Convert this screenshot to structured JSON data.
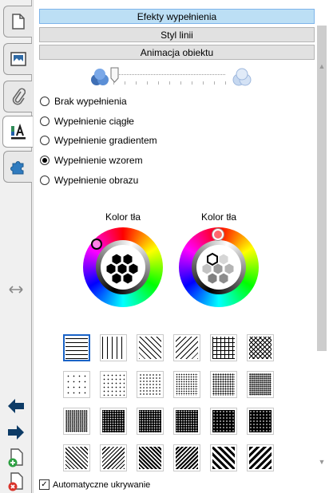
{
  "sections": {
    "fill_effects": "Efekty wypełnienia",
    "line_style": "Styl linii",
    "object_animation": "Animacja obiektu"
  },
  "transparency": {
    "value": 0
  },
  "fill_options": [
    {
      "label": "Brak wypełnienia",
      "checked": false
    },
    {
      "label": "Wypełnienie ciągłe",
      "checked": false
    },
    {
      "label": "Wypełnienie gradientem",
      "checked": false
    },
    {
      "label": "Wypełnienie wzorem",
      "checked": true
    },
    {
      "label": "Wypełnienie obrazu",
      "checked": false
    }
  ],
  "color_pickers": [
    {
      "label": "Kolor tła",
      "selected_color": "#000000"
    },
    {
      "label": "Kolor tła",
      "selected_color": "#ffffff"
    }
  ],
  "patterns": {
    "selected_index": 0,
    "items": [
      "horizontal-lines",
      "vertical-lines",
      "diagonal-down",
      "diagonal-up",
      "grid",
      "diagonal-cross",
      "dots-5",
      "dots-10",
      "dots-20",
      "dots-25",
      "dots-30",
      "dots-40",
      "dots-50",
      "dots-60",
      "dots-70",
      "dots-75",
      "dots-80",
      "dots-90",
      "wide-diagonal-down",
      "wide-diagonal-up",
      "dark-diagonal-down",
      "dark-diagonal-up",
      "thick-diagonal-down",
      "thick-diagonal-up"
    ]
  },
  "auto_hide": {
    "label": "Automatyczne ukrywanie",
    "checked": true
  },
  "colors": {
    "accent": "#1a63c7",
    "active_tab": "#bcdff5",
    "nav_arrow": "#0d3b66",
    "add_green": "#2ea043",
    "delete_red": "#d9342b"
  },
  "icons": {
    "tabs": [
      "page-icon",
      "image-icon",
      "paperclip-icon",
      "properties-icon",
      "puzzle-icon"
    ],
    "resize": "resize-arrows-icon",
    "nav": [
      "arrow-left-icon",
      "arrow-right-icon",
      "add-page-icon",
      "delete-page-icon"
    ]
  }
}
